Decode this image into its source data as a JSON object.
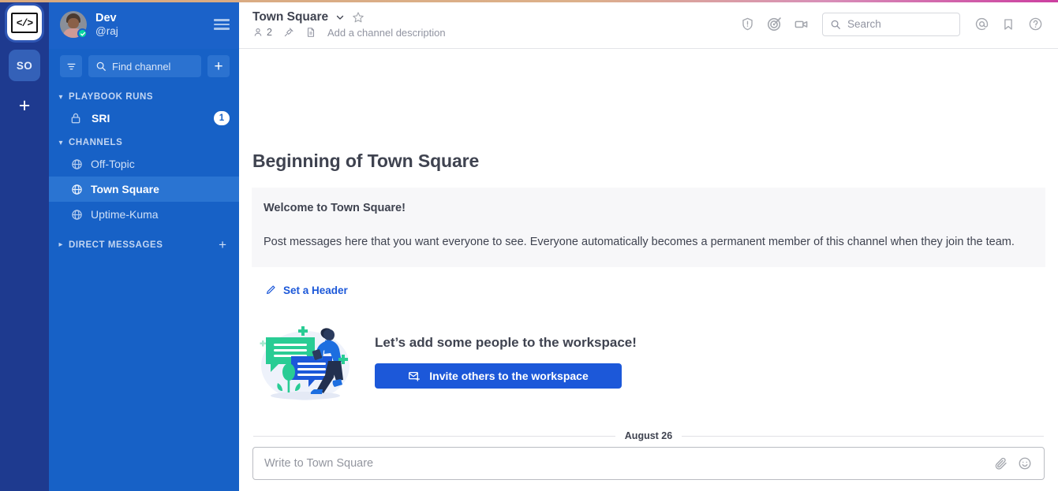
{
  "team_sidebar": {
    "active_team_icon": "code-brackets-logo",
    "teams": [
      {
        "label": "</>",
        "name": "active-team"
      },
      {
        "label": "SO",
        "name": "team-so"
      }
    ],
    "add_team_label": "+"
  },
  "sidebar": {
    "user": {
      "display_name": "Dev",
      "username": "@raj",
      "status": "online"
    },
    "menu_icon": "hamburger-icon",
    "find_channel": {
      "placeholder": "Find channel",
      "filter_icon": "filter-icon",
      "search_icon": "search-icon",
      "add_label": "+"
    },
    "categories": [
      {
        "label": "PLAYBOOK RUNS",
        "expanded": true,
        "has_add": false,
        "items": [
          {
            "label": "SRI",
            "icon": "lock-icon",
            "badge": "1",
            "active": false
          }
        ]
      },
      {
        "label": "CHANNELS",
        "expanded": true,
        "has_add": false,
        "items": [
          {
            "label": "Off-Topic",
            "icon": "globe-icon",
            "badge": "",
            "active": false
          },
          {
            "label": "Town Square",
            "icon": "globe-icon",
            "badge": "",
            "active": true
          },
          {
            "label": "Uptime-Kuma",
            "icon": "globe-icon",
            "badge": "",
            "active": false
          }
        ]
      },
      {
        "label": "DIRECT MESSAGES",
        "expanded": false,
        "has_add": true,
        "add_label": "+",
        "items": []
      }
    ]
  },
  "channel_header": {
    "title": "Town Square",
    "dropdown_icon": "chevron-down-icon",
    "favorite_icon": "star-outline-icon",
    "member_count": "2",
    "member_icon": "members-icon",
    "pin_icon": "pin-icon",
    "file_icon": "file-text-icon",
    "description_placeholder": "Add a channel description",
    "right_icons": [
      {
        "name": "playbooks-icon"
      },
      {
        "name": "target-icon"
      },
      {
        "name": "video-call-icon"
      }
    ],
    "search": {
      "placeholder": "Search",
      "icon": "search-icon"
    },
    "trailing_icons": [
      {
        "name": "at-mention-icon"
      },
      {
        "name": "saved-posts-icon"
      },
      {
        "name": "help-icon"
      }
    ]
  },
  "main": {
    "intro_title": "Beginning of Town Square",
    "welcome_title": "Welcome to Town Square!",
    "welcome_text": "Post messages here that you want everyone to see. Everyone automatically becomes a permanent member of this channel when they join the team.",
    "set_header_label": "Set a Header",
    "set_header_icon": "pencil-icon",
    "invite_heading": "Let’s add some people to the workspace!",
    "invite_button_label": "Invite others to the workspace",
    "invite_button_icon": "envelope-plus-icon",
    "illustration_name": "people-chat-illustration",
    "date_separator": "August 26"
  },
  "composer": {
    "placeholder": "Write to Town Square",
    "attach_icon": "paperclip-icon",
    "emoji_icon": "emoji-smiley-icon"
  },
  "colors": {
    "team_sidebar_bg": "#1e3a8f",
    "sidebar_bg": "#1761c6",
    "sidebar_active": "#2a74d2",
    "accent_blue": "#1c58d9",
    "link_blue": "#1c58d9",
    "status_online": "#06d6a0",
    "text_primary": "#3f4350",
    "text_muted": "#9194a1"
  }
}
